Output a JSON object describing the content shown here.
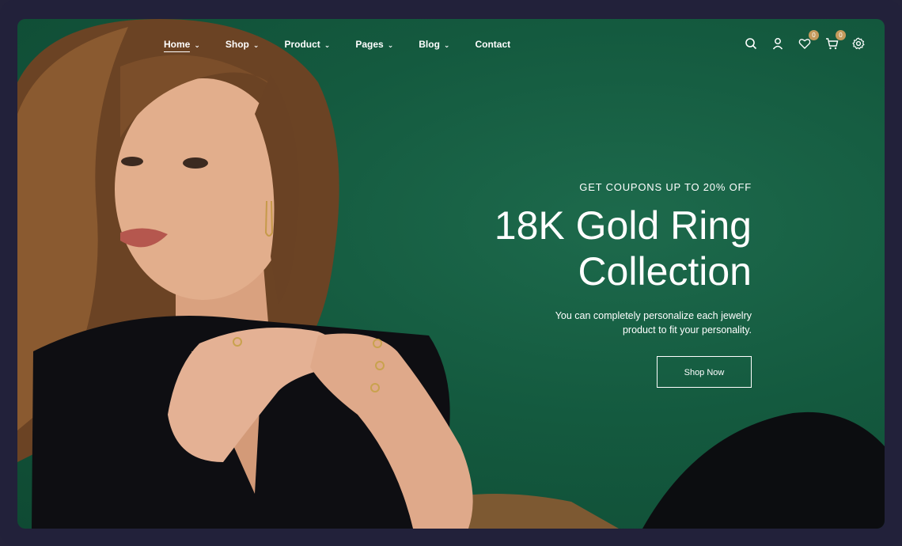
{
  "nav": {
    "items": [
      {
        "label": "Home",
        "active": true,
        "has_dropdown": true
      },
      {
        "label": "Shop",
        "active": false,
        "has_dropdown": true
      },
      {
        "label": "Product",
        "active": false,
        "has_dropdown": true
      },
      {
        "label": "Pages",
        "active": false,
        "has_dropdown": true
      },
      {
        "label": "Blog",
        "active": false,
        "has_dropdown": true
      },
      {
        "label": "Contact",
        "active": false,
        "has_dropdown": false
      }
    ],
    "chevron": "⌄"
  },
  "header_icons": {
    "search": "search-icon",
    "account": "user-icon",
    "wishlist": {
      "icon": "heart-icon",
      "count": "0"
    },
    "cart": {
      "icon": "cart-icon",
      "count": "0"
    },
    "settings": "gear-icon",
    "badge_color": "#c49a5c"
  },
  "hero": {
    "eyebrow": "GET COUPONS UP TO 20% OFF",
    "title_line1": "18K Gold Ring",
    "title_line2": "Collection",
    "description": "You can completely personalize each jewelry product to fit your personality.",
    "cta_label": "Shop Now",
    "background_color": "#145a3f"
  }
}
